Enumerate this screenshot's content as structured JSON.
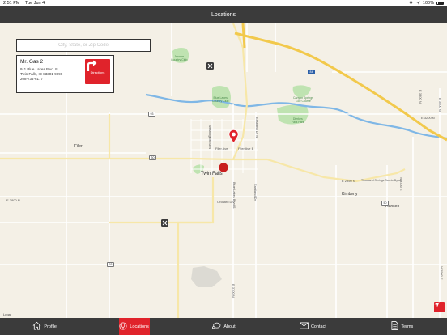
{
  "status": {
    "time": "2:51 PM",
    "date": "Tue Jun 4",
    "battery": "100%"
  },
  "nav": {
    "title": "Locations"
  },
  "search": {
    "placeholder": "City, State, or Zip Code"
  },
  "location": {
    "name": "Mr. Gas 2",
    "address_line1": "911 Blue Lakes Blvd. N.",
    "address_line2": "Twin Falls, ID 83301-9996",
    "phone": "208-734-6177",
    "directions_label": "Directions"
  },
  "map": {
    "cities": {
      "twin_falls": "Twin Falls",
      "filer": "Filer",
      "kimberly": "Kimberly",
      "hansen": "Hansen"
    },
    "parks": {
      "jerome_cc": "Jerome\nCountry Club",
      "blue_lakes_cc": "Blue Lakes\nCountry Club",
      "canyon_springs": "Canyon Springs\nGolf Course",
      "dierkes": "Dierkes\nFalls Park"
    },
    "roads": {
      "filer_ave_w": "Filer Ave",
      "filer_ave_e": "Filer Ave E",
      "washington": "Washington St N",
      "eastland": "Eastland Dr N",
      "blue_lakes_s": "Blue Lakes Blvd S",
      "eastland_s": "Eastland Dr",
      "orchard": "Orchard Dr",
      "e3800n": "E 3800 N",
      "e3200n": "E 3200 N",
      "e2950n": "E 2950 N",
      "thousand_springs": "Thousand Springs Scenic Byway",
      "e3300": "E 3300 N",
      "e3500": "E 3500 N",
      "n3300e": "N 3300 E",
      "n2900e": "N 2900 E",
      "e3700": "E 3700 N"
    },
    "shields": {
      "i84": "84",
      "us93_north": "93",
      "us30": "30",
      "us93_south": "93",
      "r50": "50"
    },
    "legal": "Legal"
  },
  "tabs": [
    {
      "label": "Profile",
      "icon": "home-icon"
    },
    {
      "label": "Locations",
      "icon": "map-pin-icon"
    },
    {
      "label": "About",
      "icon": "chat-icon"
    },
    {
      "label": "Contact",
      "icon": "mail-icon"
    },
    {
      "label": "Terms",
      "icon": "document-icon"
    }
  ],
  "colors": {
    "accent": "#e0232b",
    "bar": "#3b3b3b",
    "map_bg": "#f4f0e6",
    "highway": "#f2c94c",
    "river": "#7fb7e6",
    "park": "#bfe3b1"
  }
}
